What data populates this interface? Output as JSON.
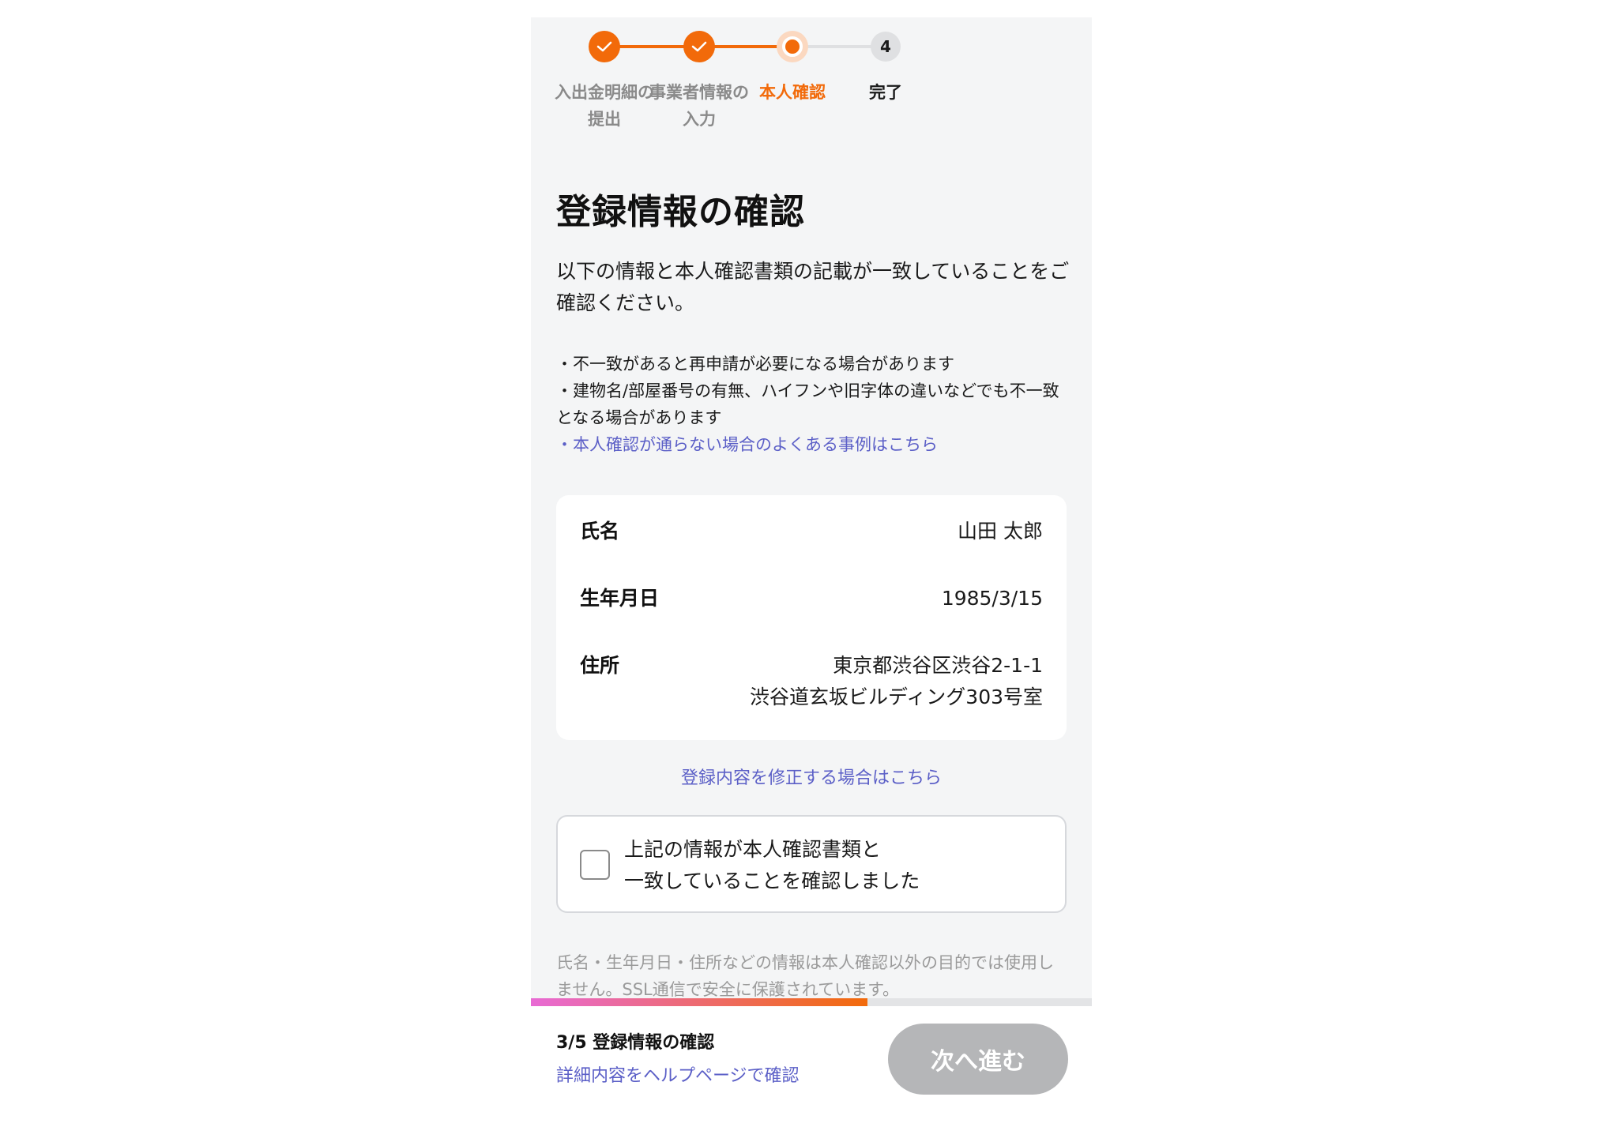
{
  "stepper": {
    "steps": [
      {
        "label_line1": "入出金明細の",
        "label_line2": "提出",
        "state": "done"
      },
      {
        "label_line1": "事業者情報の",
        "label_line2": "入力",
        "state": "done"
      },
      {
        "label_line1": "本人確認",
        "label_line2": "",
        "state": "current"
      },
      {
        "label_line1": "完了",
        "label_line2": "",
        "state": "todo",
        "number": "4"
      }
    ]
  },
  "page": {
    "title": "登録情報の確認",
    "intro": "以下の情報と本人確認書類の記載が一致していることをご確認ください。",
    "notes": [
      "・不一致があると再申請が必要になる場合があります",
      "・建物名/部屋番号の有無、ハイフンや旧字体の違いなどでも不一致となる場合があります"
    ],
    "notes_link": "・本人確認が通らない場合のよくある事例はこちら"
  },
  "info": {
    "name_label": "氏名",
    "name_value": "山田 太郎",
    "birth_label": "生年月日",
    "birth_value": "1985/3/15",
    "address_label": "住所",
    "address_line1": "東京都渋谷区渋谷2-1-1",
    "address_line2": "渋谷道玄坂ビルディング303号室"
  },
  "edit_link": "登録内容を修正する場合はこちら",
  "confirm": {
    "line1": "上記の情報が本人確認書類と",
    "line2": "一致していることを確認しました",
    "checked": false
  },
  "privacy": "氏名・生年月日・住所などの情報は本人確認以外の目的では使用しません。SSL通信で安全に保護されています。",
  "progress": {
    "fraction": 0.6
  },
  "bottom": {
    "step_count": "3/5 登録情報の確認",
    "help_link": "詳細内容をヘルプページで確認",
    "next_label": "次へ進む"
  },
  "colors": {
    "accent": "#f26a0a",
    "link": "#5b5fc7",
    "disabled": "#b5b6b8"
  }
}
